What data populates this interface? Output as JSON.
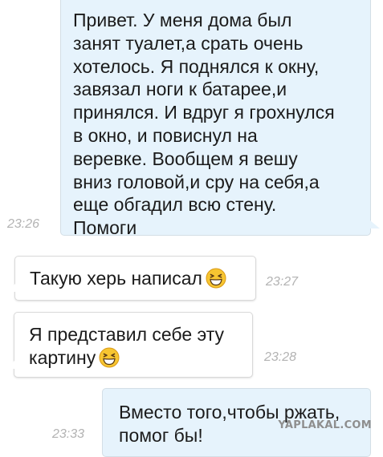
{
  "messages": [
    {
      "direction": "outgoing",
      "text": "Привет. У меня дома был\nзанят туалет,а срать очень\nхотелось. Я поднялся к окну,\nзавязал ноги к батарее,и\nпринялся. И вдруг я грохнулся\nв окно, и повиснул на\nверевке. Вообщем я вешу\nвниз головой,и сру на себя,а\nеще обгадил всю стену.\nПомоги",
      "time": "23:26"
    },
    {
      "direction": "incoming",
      "text": "Такую херь написал",
      "emoji": "grinning-face-icon",
      "time": "23:27"
    },
    {
      "direction": "incoming",
      "text": "Я представил себе эту\nкартину",
      "emoji": "grinning-face-icon",
      "time": "23:28"
    },
    {
      "direction": "outgoing",
      "text": "Вместо того,чтобы ржать,\nпомог бы!",
      "time": "23:33"
    }
  ],
  "watermark": "YAPLAKAL.COM",
  "colors": {
    "outgoing_bubble": "#e6f3fc",
    "incoming_bubble": "#ffffff",
    "timestamp": "#b3b3b3",
    "emoji_face": "#f7c531"
  }
}
